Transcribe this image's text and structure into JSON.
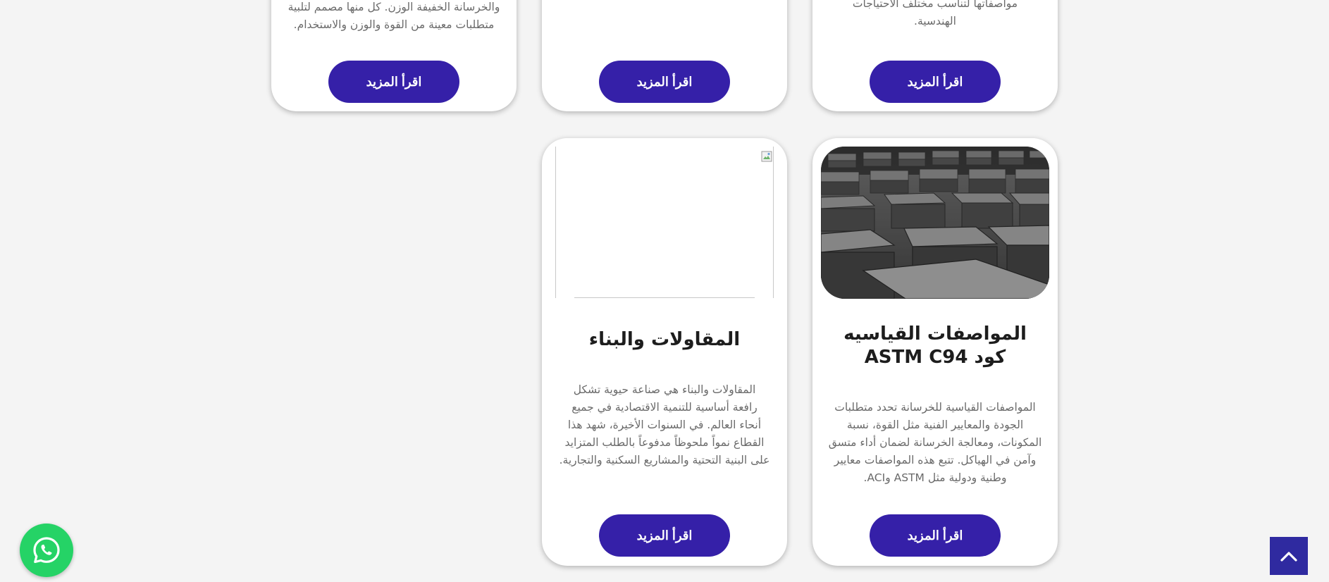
{
  "cards_top_row": [
    {
      "text_lines": [
        "والخرسانة الخفيفة الوزن. كل منها مصمم لتلبية",
        "متطلبات معينة من القوة والوزن والاستخدام."
      ],
      "button_label": "اقرأ المزيد"
    },
    {
      "text_lines": [],
      "button_label": "اقرأ المزيد"
    },
    {
      "text_lines": [
        "مواصفاتها لتناسب مختلف الاحتياجات",
        "الهندسية."
      ],
      "button_label": "اقرأ المزيد"
    }
  ],
  "card_contracting": {
    "title": "المقاولات والبناء",
    "text_lines": [
      "المقاولات والبناء هي صناعة حيوية تشكل",
      "رافعة أساسية للتنمية الاقتصادية في جميع",
      "أنحاء العالم. في السنوات الأخيرة، شهد هذا",
      "القطاع نمواً ملحوظاً مدفوعاً بالطلب المتزايد",
      "على البنية التحتية والمشاريع السكنية والتجارية."
    ],
    "button_label": "اقرأ المزيد"
  },
  "card_standards": {
    "title_lines": [
      "المواصفات القياسيه",
      "كود ASTM C94"
    ],
    "text_lines": [
      "المواصفات القياسية للخرسانة تحدد متطلبات",
      "الجودة والمعايير الفنية مثل القوة، نسبة",
      "المكونات، ومعالجة الخرسانة لضمان أداء متسق",
      "وآمن في الهياكل. تتبع هذه المواصفات معايير",
      "وطنية ودولية مثل ASTM وACI."
    ],
    "button_label": "اقرأ المزيد"
  },
  "floating": {
    "whatsapp_icon": "whatsapp-icon",
    "scroll_top_icon": "chevron-up-icon"
  },
  "colors": {
    "button": "#3520a8",
    "whatsapp": "#25d366",
    "scroll_top": "#2f2aa0",
    "background": "#f4f4f4"
  }
}
